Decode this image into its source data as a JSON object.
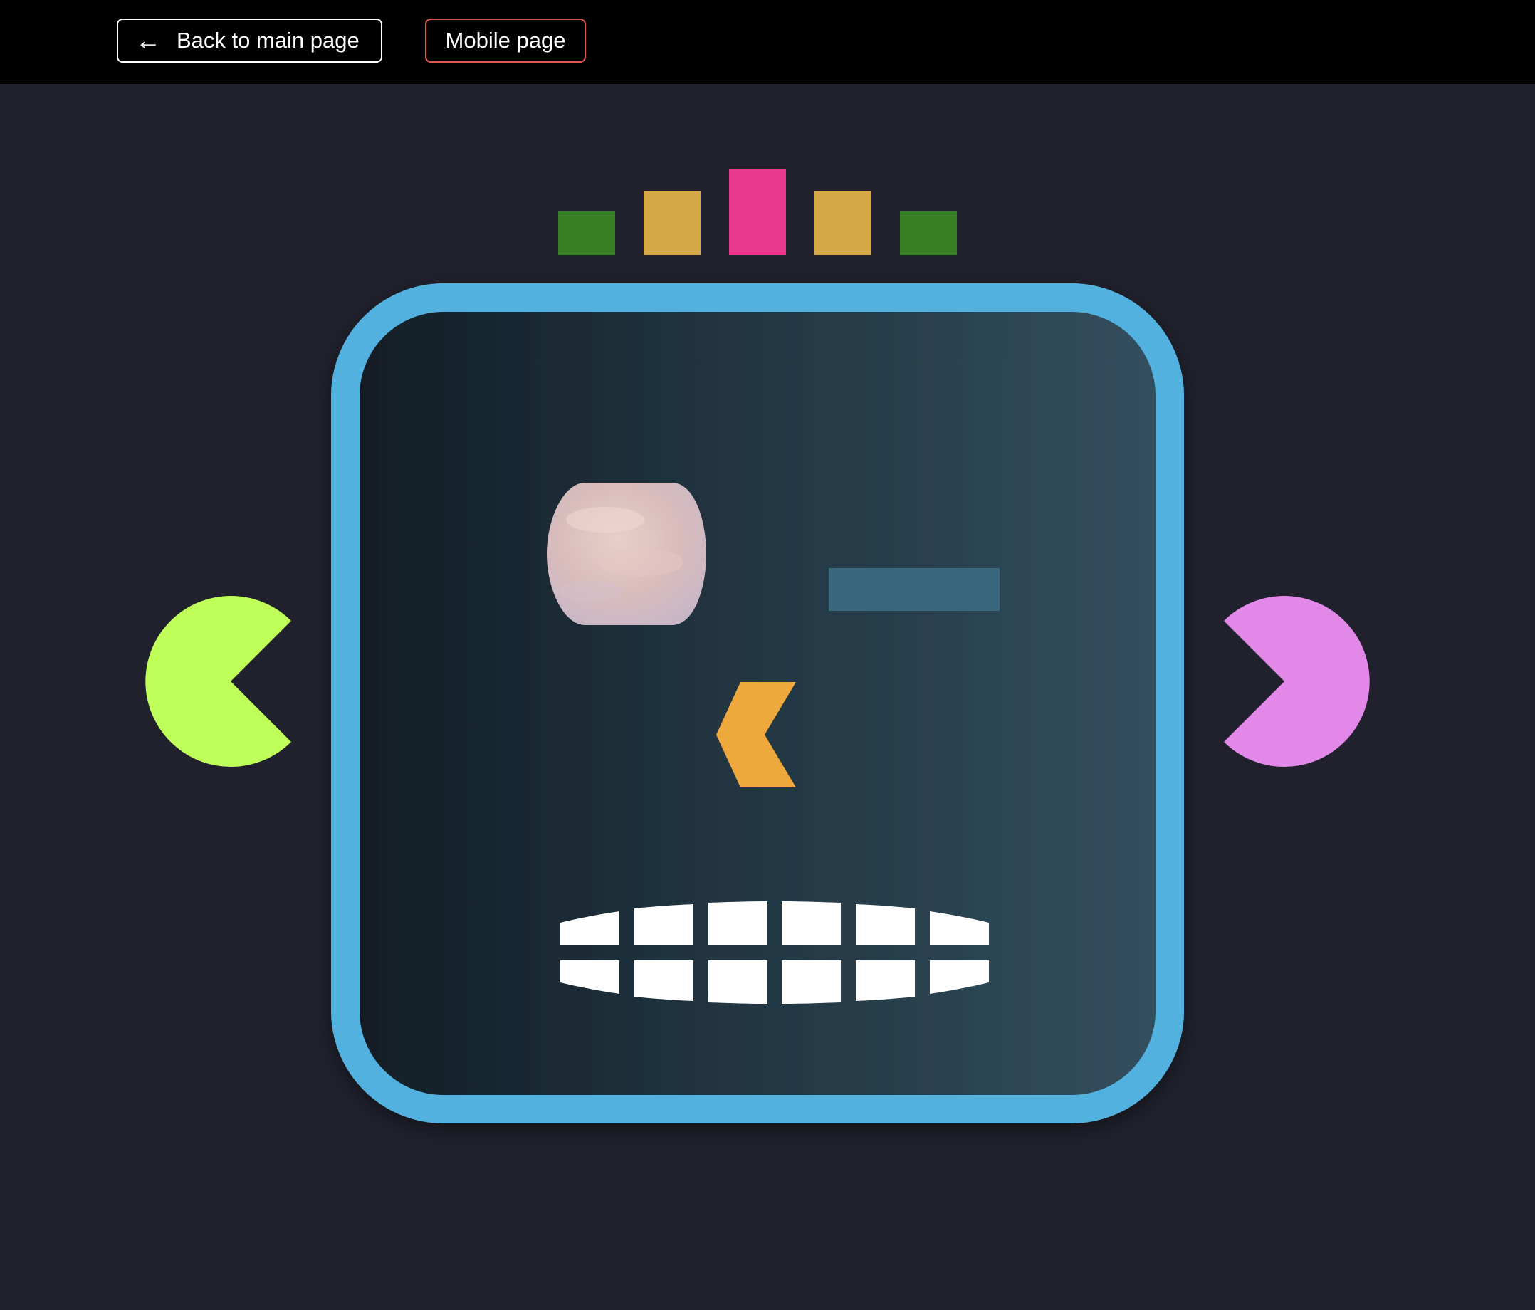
{
  "nav": {
    "back_arrow": "←",
    "back_label": "Back to main page",
    "mobile_label": "Mobile page"
  },
  "colors": {
    "page_background": "#20212c",
    "topbar": "#000000",
    "head_border": "#52b1df",
    "head_gradient_start": "#121d25",
    "head_gradient_end": "#335060",
    "antenna_green": "#367f23",
    "antenna_gold": "#d3a845",
    "antenna_pink": "#ea3990",
    "left_ear": "#c0ff5a",
    "right_ear": "#e188e8",
    "nose": "#efa83b",
    "closed_eye": "#39677e",
    "teeth": "#ffffff",
    "mobile_button_border": "#e0584f"
  },
  "icons": {
    "back": "left-arrow-icon"
  }
}
